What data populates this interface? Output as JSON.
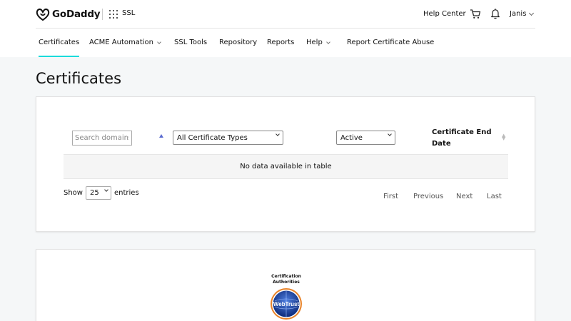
{
  "header": {
    "logo_text": "GoDaddy",
    "product": "SSL",
    "help_center": "Help Center",
    "user_name": "Janis"
  },
  "nav": {
    "items": [
      {
        "label": "Certificates",
        "active": true
      },
      {
        "label": "ACME Automation",
        "dropdown": true
      },
      {
        "label": "SSL Tools"
      },
      {
        "label": "Repository"
      },
      {
        "label": "Reports"
      },
      {
        "label": "Help",
        "dropdown": true
      },
      {
        "label": "Report Certificate Abuse"
      }
    ]
  },
  "page": {
    "title": "Certificates"
  },
  "table": {
    "search_placeholder": "Search domains",
    "type_filter": "All Certificate Types",
    "status_filter": "Active",
    "end_date_header": "Certificate End Date",
    "empty_message": "No data available in table",
    "show_label": "Show",
    "page_length": "25",
    "entries_label": "entries",
    "pager": {
      "first": "First",
      "previous": "Previous",
      "next": "Next",
      "last": "Last"
    }
  },
  "badge": {
    "line1": "Certification",
    "line2": "Authorities",
    "seal_text": "WebTrust"
  },
  "colors": {
    "accent": "#1bdbdb",
    "sort_arrow": "#5a6bd0",
    "seal_blue": "#1a3a9c",
    "seal_orange": "#e8832a"
  }
}
